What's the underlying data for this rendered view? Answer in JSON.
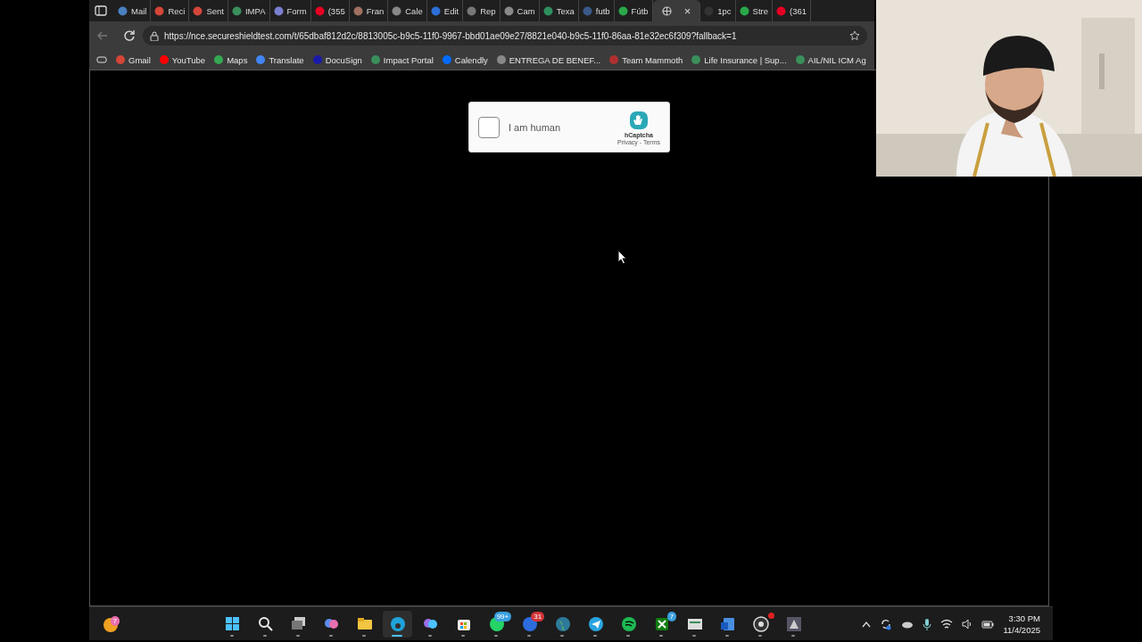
{
  "browser": {
    "tabs": [
      {
        "label": "Mail",
        "selected": false,
        "color": "#4a7fc1"
      },
      {
        "label": "Reci",
        "selected": false,
        "color": "#d44638"
      },
      {
        "label": "Sent",
        "selected": false,
        "color": "#d44638"
      },
      {
        "label": "IMPA",
        "selected": false,
        "color": "#3a8f5a"
      },
      {
        "label": "Form",
        "selected": false,
        "color": "#7b7fd0"
      },
      {
        "label": "(355",
        "selected": false,
        "color": "#e60023"
      },
      {
        "label": "Fran",
        "selected": false,
        "color": "#a07060"
      },
      {
        "label": "Cale",
        "selected": false,
        "color": "#888888"
      },
      {
        "label": "Edit",
        "selected": false,
        "color": "#2b6fd6"
      },
      {
        "label": "Rep",
        "selected": false,
        "color": "#777777"
      },
      {
        "label": "Cam",
        "selected": false,
        "color": "#888888"
      },
      {
        "label": "Texa",
        "selected": false,
        "color": "#2f8f5f"
      },
      {
        "label": "futb",
        "selected": false,
        "color": "#3a5a8a"
      },
      {
        "label": "Fútb",
        "selected": false,
        "color": "#2aa84a"
      },
      {
        "selected": true,
        "color": "#cccccc",
        "close": "×"
      },
      {
        "label": "1pc",
        "selected": false,
        "color": "#333333"
      },
      {
        "label": "Stre",
        "selected": false,
        "color": "#2aa84a"
      },
      {
        "label": "(361",
        "selected": false,
        "color": "#e60023"
      }
    ],
    "url": "https://nce.secureshieldtest.com/t/65dbaf812d2c/8813005c-b9c5-11f0-9967-bbd01ae09e27/8821e040-b9c5-11f0-86aa-81e32ec6f309?fallback=1",
    "bookmarks": [
      {
        "label": "Gmail",
        "color": "#d44638"
      },
      {
        "label": "YouTube",
        "color": "#ff0000"
      },
      {
        "label": "Maps",
        "color": "#34a853"
      },
      {
        "label": "Translate",
        "color": "#4285f4"
      },
      {
        "label": "DocuSign",
        "color": "#1a1aaa"
      },
      {
        "label": "Impact Portal",
        "color": "#3a8f5a"
      },
      {
        "label": "Calendly",
        "color": "#006bff"
      },
      {
        "label": "ENTREGA DE BENEF...",
        "color": "#888888"
      },
      {
        "label": "Team Mammoth",
        "color": "#b03030"
      },
      {
        "label": "Life Insurance | Sup...",
        "color": "#3a8f5a"
      },
      {
        "label": "AIL/NIL ICM Ag",
        "color": "#3a8f5a"
      }
    ]
  },
  "captcha": {
    "checked": false,
    "label": "I am human",
    "brand": "hCaptcha",
    "links": "Privacy - Terms"
  },
  "taskbar": {
    "widget_badge": "7",
    "apps": [
      {
        "selected": false
      },
      {
        "selected": false
      },
      {
        "selected": false
      },
      {
        "selected": false
      },
      {
        "selected": false
      },
      {
        "selected": true
      },
      {
        "selected": false
      },
      {
        "selected": false
      },
      {
        "selected": false,
        "badge": "99+"
      },
      {
        "selected": false,
        "badge": "31"
      },
      {
        "selected": false
      },
      {
        "selected": false
      },
      {
        "selected": false
      },
      {
        "selected": false,
        "badge": "7"
      },
      {
        "selected": false
      },
      {
        "selected": false
      },
      {
        "selected": false,
        "alert": true
      },
      {
        "selected": false
      }
    ],
    "time": "3:30 PM",
    "date": "11/4/2025"
  }
}
